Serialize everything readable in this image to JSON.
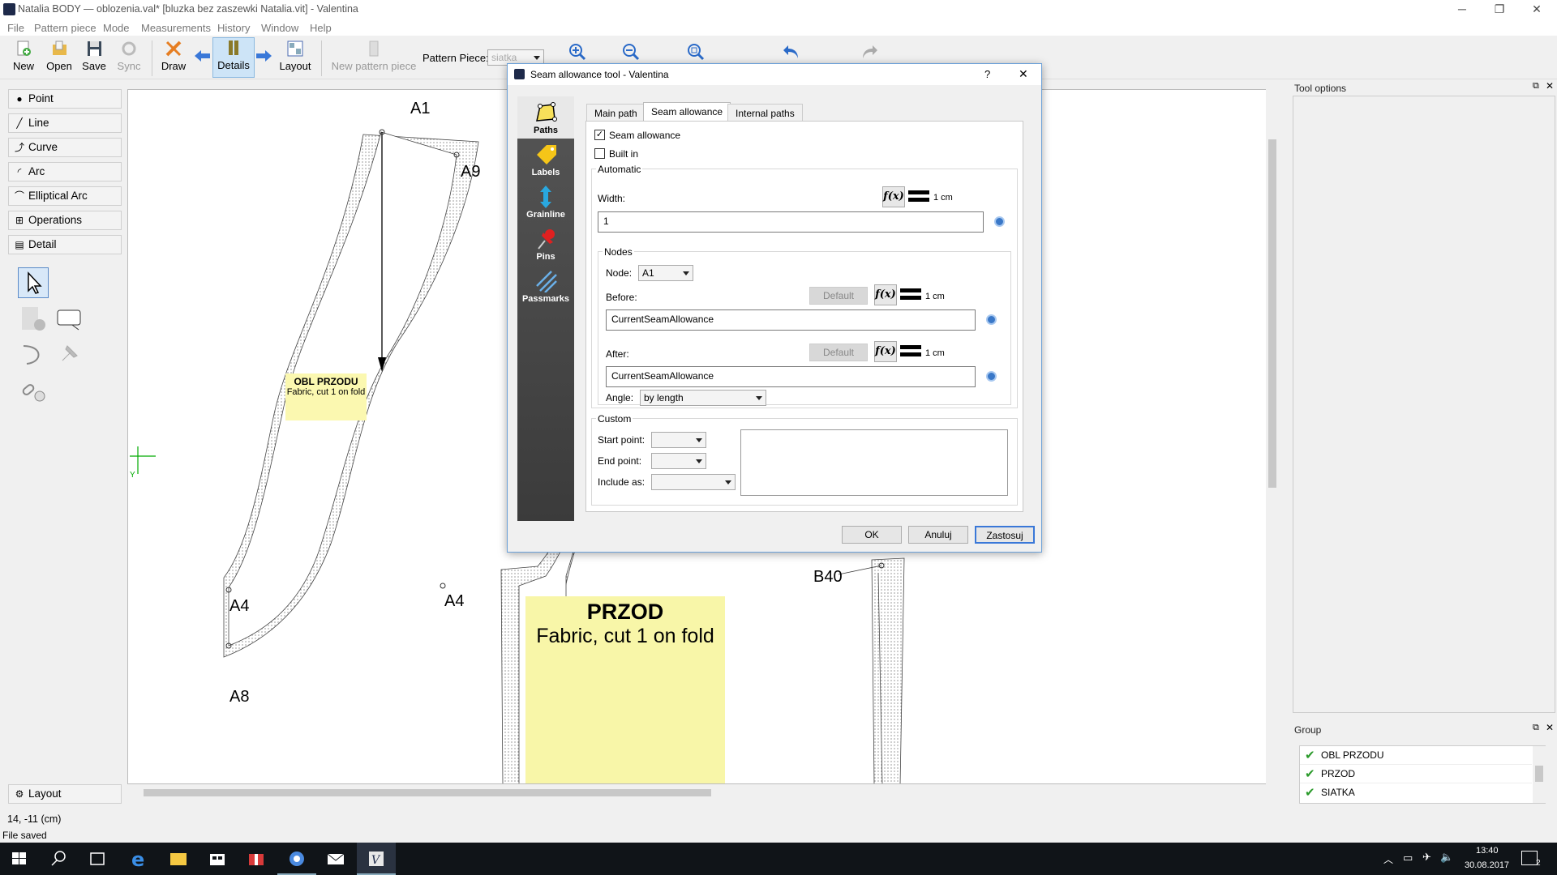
{
  "window": {
    "title": "Natalia BODY — oblozenia.val* [bluzka bez zaszewki Natalia.vit] - Valentina"
  },
  "menu": [
    "File",
    "Pattern piece",
    "Mode",
    "Measurements",
    "History",
    "Window",
    "Help"
  ],
  "toolbar": {
    "new": "New",
    "open": "Open",
    "save": "Save",
    "sync": "Sync",
    "draw": "Draw",
    "details": "Details",
    "layout": "Layout",
    "new_pattern_piece": "New pattern piece",
    "pattern_piece_label": "Pattern Piece:",
    "pattern_piece_value": "siatka"
  },
  "left_panel": {
    "buttons": [
      "Point",
      "Line",
      "Curve",
      "Arc",
      "Elliptical Arc",
      "Operations",
      "Detail"
    ],
    "layout": "Layout"
  },
  "canvas": {
    "points": [
      "A1",
      "A9",
      "A4",
      "A8",
      "A4",
      "B40"
    ],
    "label_small": {
      "title": "OBL PRZODU",
      "subtitle": "Fabric, cut 1 on fold"
    },
    "label_large": {
      "title": "PRZOD",
      "subtitle": "Fabric, cut 1 on fold"
    },
    "axis_y": "Y"
  },
  "dialog": {
    "title": "Seam allowance tool - Valentina",
    "help": "?",
    "close": "✕",
    "sidebar": [
      "Paths",
      "Labels",
      "Grainline",
      "Pins",
      "Passmarks"
    ],
    "tabs": [
      "Main path",
      "Seam allowance",
      "Internal paths"
    ],
    "active_tab": "Seam allowance",
    "seam_allowance_label": "Seam allowance",
    "seam_allowance_checked": true,
    "built_in_label": "Built in",
    "built_in_checked": false,
    "automatic": {
      "group": "Automatic",
      "width_label": "Width:",
      "width_unit": "1 cm",
      "width_value": "1"
    },
    "nodes": {
      "group": "Nodes",
      "node_label": "Node:",
      "node_value": "A1",
      "before_label": "Before:",
      "before_default": "Default",
      "before_unit": "1 cm",
      "before_value": "CurrentSeamAllowance",
      "after_label": "After:",
      "after_default": "Default",
      "after_unit": "1 cm",
      "after_value": "CurrentSeamAllowance",
      "angle_label": "Angle:",
      "angle_value": "by length"
    },
    "custom": {
      "group": "Custom",
      "start_point": "Start point:",
      "end_point": "End point:",
      "include_as": "Include as:"
    },
    "buttons": {
      "ok": "OK",
      "cancel": "Anuluj",
      "apply": "Zastosuj"
    }
  },
  "right_panel": {
    "tool_options": "Tool options",
    "group_title": "Group",
    "groups": [
      "OBL PRZODU",
      "PRZOD",
      "SIATKA"
    ]
  },
  "status": {
    "coords": "14, -11 (cm)",
    "message": "File saved"
  },
  "taskbar": {
    "time": "13:40",
    "date": "30.08.2017",
    "notifications": "2"
  }
}
